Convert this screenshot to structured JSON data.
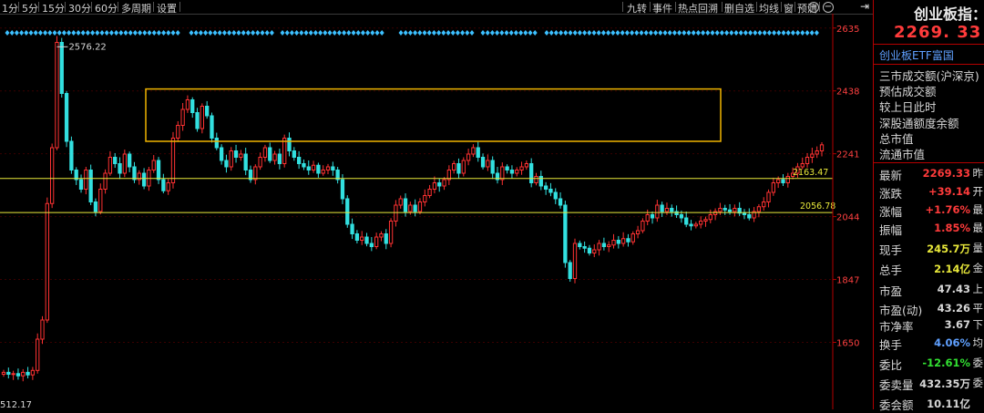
{
  "toolbar": {
    "periods": [
      "1分",
      "5分",
      "15分",
      "30分",
      "60分",
      "多周期",
      "设置"
    ],
    "tools": [
      "九转",
      "事件",
      "热点回溯",
      "删自选",
      "均线",
      "窗",
      "预测"
    ]
  },
  "chart_data": {
    "type": "candlestick",
    "y_axis_ticks": [
      "2635",
      "2438",
      "2241",
      "2044",
      "1847",
      "1650"
    ],
    "ylim": [
      1440,
      2680
    ],
    "annotations": {
      "high_label": "2576.22",
      "low_label": "512.17",
      "line_upper_label": "2163.47",
      "line_lower_label": "2056.78"
    },
    "horizontal_lines": [
      2163.47,
      2056.78
    ],
    "rectangle_price_range": [
      2280,
      2444
    ],
    "colors": {
      "up": "#ff3232",
      "down": "#32e0e0",
      "lines": "#e8e83a",
      "rect": "#f0b400"
    },
    "closes": [
      1556,
      1550,
      1552,
      1545,
      1556,
      1548,
      1562,
      1660,
      1720,
      2085,
      2260,
      2590,
      2430,
      2280,
      2190,
      2160,
      2130,
      2190,
      2090,
      2060,
      2130,
      2180,
      2230,
      2210,
      2180,
      2240,
      2200,
      2160,
      2180,
      2140,
      2190,
      2220,
      2160,
      2125,
      2150,
      2290,
      2330,
      2380,
      2410,
      2370,
      2320,
      2390,
      2360,
      2290,
      2260,
      2220,
      2200,
      2250,
      2230,
      2240,
      2190,
      2160,
      2200,
      2230,
      2260,
      2220,
      2240,
      2210,
      2290,
      2250,
      2230,
      2210,
      2200,
      2190,
      2205,
      2180,
      2190,
      2200,
      2190,
      2160,
      2100,
      2020,
      1990,
      1970,
      1980,
      1960,
      1950,
      1980,
      1990,
      1960,
      2030,
      2080,
      2100,
      2060,
      2080,
      2060,
      2090,
      2110,
      2130,
      2150,
      2140,
      2160,
      2190,
      2210,
      2180,
      2220,
      2240,
      2260,
      2230,
      2200,
      2220,
      2180,
      2160,
      2200,
      2190,
      2180,
      2190,
      2200,
      2210,
      2150,
      2170,
      2140,
      2130,
      2120,
      2100,
      2080,
      1900,
      1850,
      1960,
      1950,
      1945,
      1930,
      1940,
      1960,
      1950,
      1955,
      1970,
      1960,
      1975,
      1965,
      1990,
      2000,
      2030,
      2050,
      2040,
      2080,
      2060,
      2070,
      2060,
      2050,
      2040,
      2020,
      2015,
      2020,
      2030,
      2035,
      2050,
      2060,
      2070,
      2065,
      2060,
      2070,
      2055,
      2050,
      2040,
      2060,
      2075,
      2090,
      2120,
      2150,
      2160,
      2150,
      2170,
      2180,
      2200,
      2210,
      2230,
      2240,
      2250,
      2269
    ]
  },
  "panel": {
    "title": "创业板指：",
    "price": "2269. 33",
    "etf_link": "创业板ETF富国",
    "labels": [
      "三市成交额(沪深京)",
      "预估成交额",
      "较上日此时",
      "深股通额度余额",
      "总市值",
      "流通市值"
    ],
    "rows": [
      {
        "label": "最新",
        "value": "2269.33",
        "suffix": "昨",
        "color": "#ff3b3b"
      },
      {
        "label": "涨跌",
        "value": "+39.14",
        "suffix": "开",
        "color": "#ff3b3b"
      },
      {
        "label": "涨幅",
        "value": "+1.76%",
        "suffix": "最",
        "color": "#ff3b3b"
      },
      {
        "label": "振幅",
        "value": "1.85%",
        "suffix": "最",
        "color": "#ff3b3b"
      },
      {
        "label": "现手",
        "value": "245.7万",
        "suffix": "量",
        "color": "#e8e83a"
      },
      {
        "label": "总手",
        "value": "2.14亿",
        "suffix": "金",
        "color": "#e8e83a"
      },
      {
        "label": "市盈",
        "value": "47.43",
        "suffix": "上",
        "color": "#d8d8d8"
      },
      {
        "label": "市盈(动)",
        "value": "43.26",
        "suffix": "平",
        "color": "#d8d8d8"
      },
      {
        "label": "市净率",
        "value": "3.67",
        "suffix": "下",
        "color": "#d8d8d8"
      },
      {
        "label": "换手",
        "value": "4.06%",
        "suffix": "均",
        "color": "#5fa0ff"
      },
      {
        "label": "委比",
        "value": "-12.61%",
        "suffix": "委",
        "color": "#32e032"
      },
      {
        "label": "委卖量",
        "value": "432.35万",
        "suffix": "委",
        "color": "#d8d8d8"
      },
      {
        "label": "委会额",
        "value": "10.11亿",
        "suffix": "",
        "color": "#d8d8d8"
      }
    ]
  }
}
